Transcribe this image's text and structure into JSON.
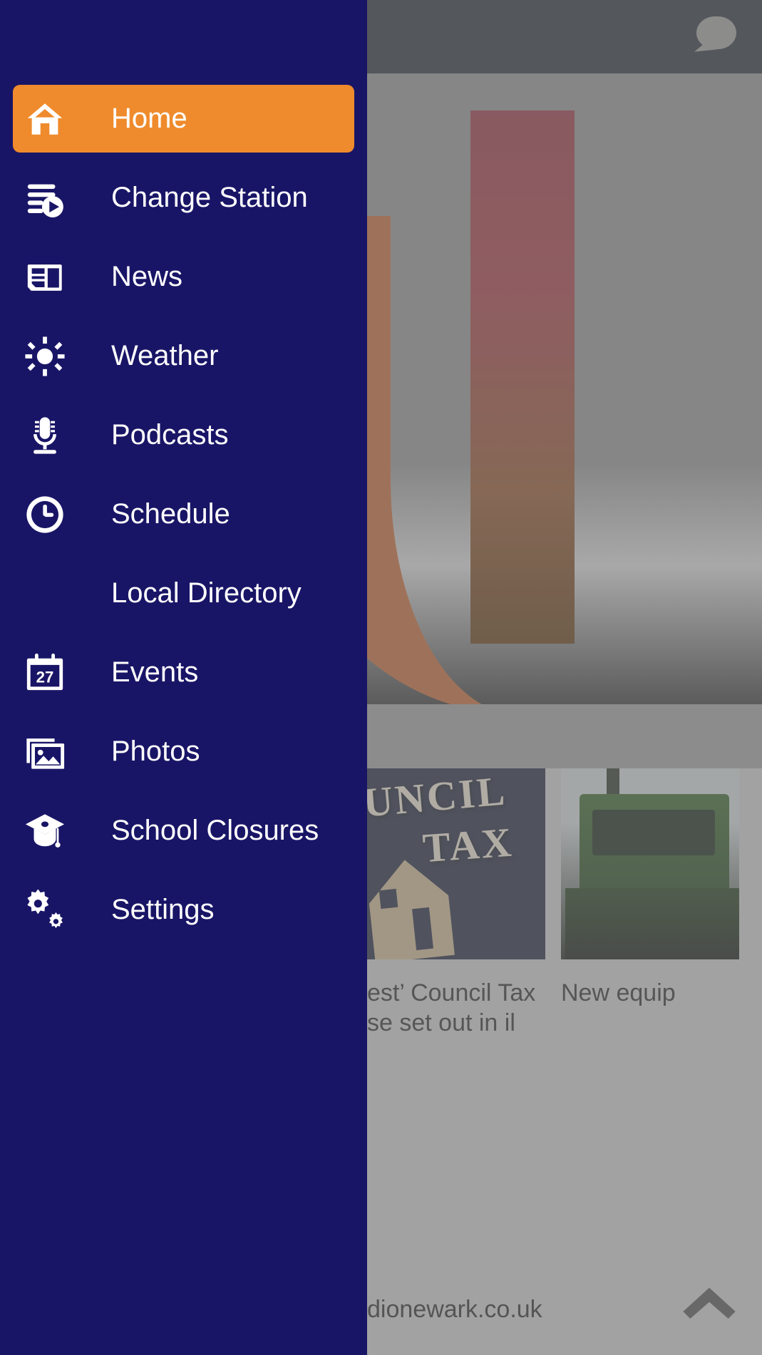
{
  "app": {
    "accent_navy": "#191566",
    "accent_orange": "#ef8b2c",
    "appbar_color": "#1d2430",
    "scrim_color": "#828282"
  },
  "appbar": {
    "chat_icon": "chat-bubble-icon"
  },
  "drawer": {
    "items": [
      {
        "label": "Home",
        "icon": "home-icon",
        "active": true
      },
      {
        "label": "Change Station",
        "icon": "playlist-play-icon",
        "active": false
      },
      {
        "label": "News",
        "icon": "newspaper-icon",
        "active": false
      },
      {
        "label": "Weather",
        "icon": "sun-icon",
        "active": false
      },
      {
        "label": "Podcasts",
        "icon": "microphone-icon",
        "active": false
      },
      {
        "label": "Schedule",
        "icon": "clock-icon",
        "active": false
      },
      {
        "label": "Local Directory",
        "icon": "none",
        "active": false
      },
      {
        "label": "Events",
        "icon": "calendar-27-icon",
        "active": false
      },
      {
        "label": "Photos",
        "icon": "photo-stack-icon",
        "active": false
      },
      {
        "label": "School Closures",
        "icon": "graduation-cap-icon",
        "active": false
      },
      {
        "label": "Settings",
        "icon": "gears-icon",
        "active": false
      }
    ]
  },
  "content": {
    "calendar_day": "27",
    "cards": [
      {
        "title": "est’ Council Tax\nse set out in\nil",
        "image": "council-tax-wooden-letters"
      },
      {
        "title": "New\nequip",
        "image": "green-tractor"
      }
    ],
    "footer_url": "dionewark.co.uk",
    "scroll_top_icon": "chevron-up-icon"
  }
}
